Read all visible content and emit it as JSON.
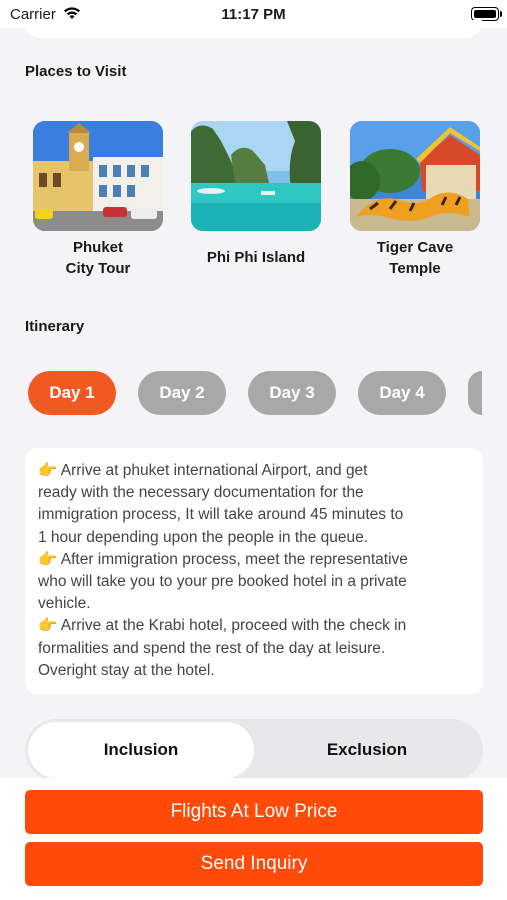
{
  "status_bar": {
    "carrier": "Carrier",
    "time": "11:17 PM"
  },
  "places": {
    "title": "Places to Visit",
    "items": [
      {
        "name_line1": "Phuket",
        "name_line2": "City Tour"
      },
      {
        "name_line1": "Phi Phi Island",
        "name_line2": ""
      },
      {
        "name_line1": "Tiger Cave",
        "name_line2": "Temple"
      }
    ]
  },
  "itinerary": {
    "title": "Itinerary",
    "days": [
      "Day 1",
      "Day 2",
      "Day 3",
      "Day 4"
    ],
    "selected_day": "Day 1",
    "lines": [
      "👉 Arrive at phuket international Airport, and get",
      "ready with the necessary documentation for the",
      "immigration process, It will take around 45 minutes to",
      "1 hour depending upon the people in the queue.",
      "👉 After immigration process, meet the representative",
      "who will take you to your pre booked hotel in a private",
      "vehicle.",
      "👉 Arrive at the Krabi hotel, proceed with the check in",
      "formalities and spend the rest of the day at leisure.",
      "Overight stay at the hotel."
    ]
  },
  "tabs": {
    "inclusion": "Inclusion",
    "exclusion": "Exclusion",
    "selected": "Inclusion"
  },
  "actions": {
    "flights": "Flights At Low Price",
    "inquiry": "Send Inquiry"
  },
  "colors": {
    "accent": "#f05a22",
    "cta": "#ff4a0a",
    "chip_inactive": "#a8a8a8"
  }
}
